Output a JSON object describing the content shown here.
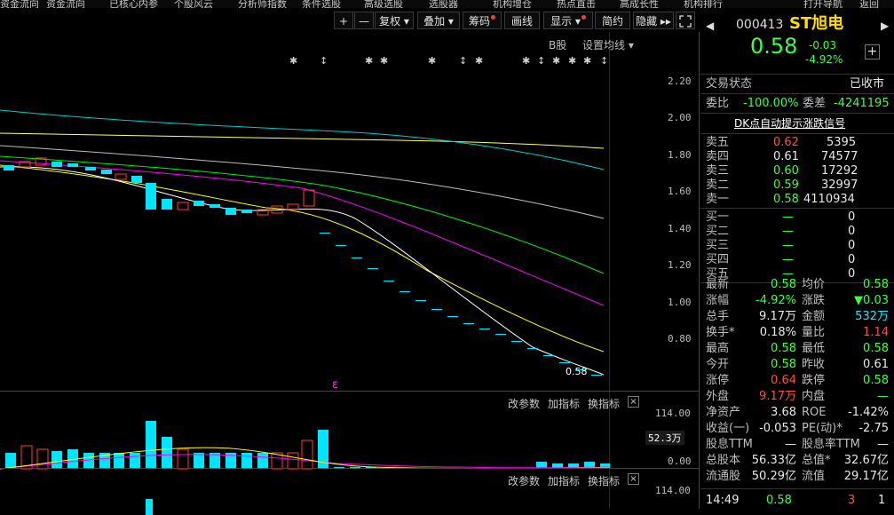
{
  "top_menu": [
    "资金流向",
    "资金流向",
    "已核心内参",
    "个股风云",
    "分析师指数",
    "条件选股",
    "高级选股",
    "选股器",
    "机构增仓",
    "热点直击",
    "高成长性",
    "机构排行",
    "打开导航",
    "返回"
  ],
  "toolbar": {
    "plus": "+",
    "minus": "—",
    "fuquan": "复权 ▾",
    "diejia": "叠加 ▾",
    "chouma": "筹码",
    "huaxian": "画线",
    "xianshi": "显示 ▾",
    "jianyue": "简约",
    "yincang": "隐藏 ▸▸",
    "fullscreen_icon": "expand-icon"
  },
  "chart": {
    "b_label": "B股",
    "ma_setting": "设置均线 ▾",
    "y_ticks": [
      "2.20",
      "2.00",
      "1.80",
      "1.60",
      "1.40",
      "1.20",
      "1.00",
      "0.80"
    ],
    "last_price_label": "0.58",
    "event_marker": "ε",
    "colors": {
      "up": "#ff3b3b",
      "down": "#00e5ff",
      "ma5": "#ffffff",
      "ma10": "#ffff00",
      "ma20": "#ff00ff",
      "ma30": "#00ff00",
      "ma60": "#c0c0c0",
      "ma120": "#00ffff",
      "ma250": "#ffff66"
    }
  },
  "volume_panel": {
    "buttons": [
      "改参数",
      "加指标",
      "换指标"
    ],
    "close_icon": "close-icon",
    "y_ticks": [
      "114.00",
      "0.00"
    ],
    "current_label": "52.3万"
  },
  "panel3": {
    "buttons": [
      "改参数",
      "加指标",
      "换指标"
    ],
    "close_icon": "close-icon",
    "y_tick": "114.00"
  },
  "quote": {
    "code": "000413",
    "name": "ST旭电",
    "price": "0.58",
    "change": "-0.03",
    "change_pct": "-4.92%",
    "add_icon": "+",
    "status_label": "交易状态",
    "status_value": "已收市",
    "weibi_label": "委比",
    "weibi_value": "-100.00%",
    "weicha_label": "委差",
    "weicha_value": "-4241195",
    "dk_link": "DK点自动提示涨跌信号",
    "asks": [
      {
        "label": "卖五",
        "price": "0.62",
        "vol": "5395",
        "color": "red"
      },
      {
        "label": "卖四",
        "price": "0.61",
        "vol": "74577",
        "color": "white"
      },
      {
        "label": "卖三",
        "price": "0.60",
        "vol": "17292",
        "color": "green"
      },
      {
        "label": "卖二",
        "price": "0.59",
        "vol": "32997",
        "color": "green"
      },
      {
        "label": "卖一",
        "price": "0.58",
        "vol": "4110934",
        "color": "green"
      }
    ],
    "bids": [
      {
        "label": "买一",
        "price": "—",
        "vol": "0"
      },
      {
        "label": "买二",
        "price": "—",
        "vol": "0"
      },
      {
        "label": "买三",
        "price": "—",
        "vol": "0"
      },
      {
        "label": "买四",
        "price": "—",
        "vol": "0"
      },
      {
        "label": "买五",
        "price": "—",
        "vol": "0"
      }
    ],
    "stats": [
      {
        "l1": "最新",
        "v1": "0.58",
        "c1": "green",
        "l2": "均价",
        "v2": "0.58",
        "c2": "green"
      },
      {
        "l1": "涨幅",
        "v1": "-4.92%",
        "c1": "green",
        "l2": "涨跌",
        "v2": "▼0.03",
        "c2": "green"
      },
      {
        "l1": "总手",
        "v1": "9.17万",
        "c1": "white",
        "l2": "金额",
        "v2": "532万",
        "c2": "cyan"
      },
      {
        "l1": "换手*",
        "v1": "0.18%",
        "c1": "white",
        "l2": "量比",
        "v2": "1.14",
        "c2": "red"
      },
      {
        "l1": "最高",
        "v1": "0.58",
        "c1": "green",
        "l2": "最低",
        "v2": "0.58",
        "c2": "green"
      },
      {
        "l1": "今开",
        "v1": "0.58",
        "c1": "green",
        "l2": "昨收",
        "v2": "0.61",
        "c2": "white"
      },
      {
        "l1": "涨停",
        "v1": "0.64",
        "c1": "red",
        "l2": "跌停",
        "v2": "0.58",
        "c2": "green"
      },
      {
        "l1": "外盘",
        "v1": "9.17万",
        "c1": "red",
        "l2": "内盘",
        "v2": "—",
        "c2": "green"
      },
      {
        "l1": "净资产",
        "v1": "3.68",
        "c1": "white",
        "l2": "ROE",
        "v2": "-1.42%",
        "c2": "white"
      },
      {
        "l1": "收益(一)",
        "v1": "-0.053",
        "c1": "white",
        "l2": "PE(动)*",
        "v2": "-2.75",
        "c2": "white"
      },
      {
        "l1": "股息TTM",
        "v1": "—",
        "c1": "white",
        "l2": "股息率TTM",
        "v2": "—",
        "c2": "white"
      },
      {
        "l1": "总股本",
        "v1": "56.33亿",
        "c1": "white",
        "l2": "总值*",
        "v2": "32.67亿",
        "c2": "white"
      },
      {
        "l1": "流通股",
        "v1": "50.29亿",
        "c1": "white",
        "l2": "流值",
        "v2": "29.17亿",
        "c2": "white"
      }
    ],
    "tick": {
      "time": "14:49",
      "price": "0.58",
      "vol": "3",
      "flag": "1"
    }
  }
}
